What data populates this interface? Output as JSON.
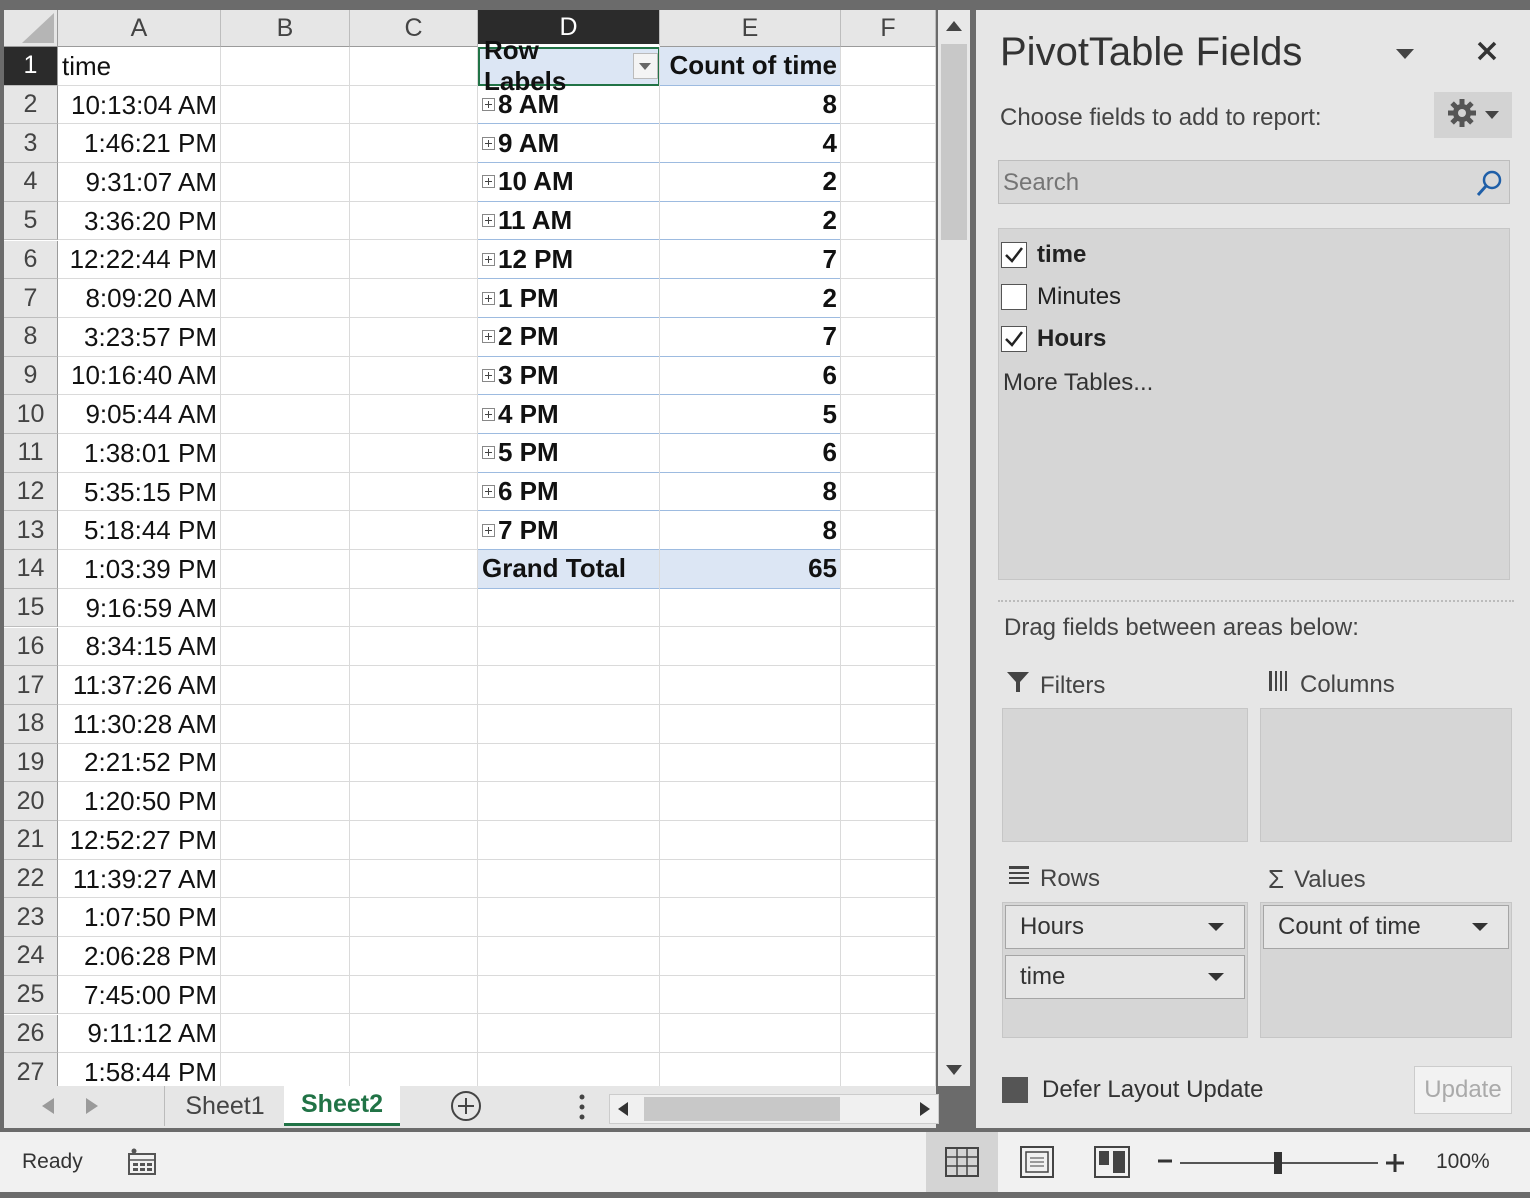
{
  "sheet": {
    "columns": [
      "A",
      "B",
      "C",
      "D",
      "E",
      "F"
    ],
    "selected_column": "D",
    "row_numbers": [
      "1",
      "2",
      "3",
      "4",
      "5",
      "6",
      "7",
      "8",
      "9",
      "10",
      "11",
      "12",
      "13",
      "14",
      "15",
      "16",
      "17",
      "18",
      "19",
      "20",
      "21",
      "22",
      "23",
      "24",
      "25",
      "26",
      "27"
    ],
    "colA_header": "time",
    "colA_values": [
      "10:13:04 AM",
      "1:46:21 PM",
      "9:31:07 AM",
      "3:36:20 PM",
      "12:22:44 PM",
      "8:09:20 AM",
      "3:23:57 PM",
      "10:16:40 AM",
      "9:05:44 AM",
      "1:38:01 PM",
      "5:35:15 PM",
      "5:18:44 PM",
      "1:03:39 PM",
      "9:16:59 AM",
      "8:34:15 AM",
      "11:37:26 AM",
      "11:30:28 AM",
      "2:21:52 PM",
      "1:20:50 PM",
      "12:52:27 PM",
      "11:39:27 AM",
      "1:07:50 PM",
      "2:06:28 PM",
      "7:45:00 PM",
      "9:11:12 AM",
      "1:58:44 PM"
    ]
  },
  "pivot": {
    "row_labels_header": "Row Labels",
    "values_header": "Count of time",
    "rows": [
      {
        "label": "8 AM",
        "count": "8"
      },
      {
        "label": "9 AM",
        "count": "4"
      },
      {
        "label": "10 AM",
        "count": "2"
      },
      {
        "label": "11 AM",
        "count": "2"
      },
      {
        "label": "12 PM",
        "count": "7"
      },
      {
        "label": "1 PM",
        "count": "2"
      },
      {
        "label": "2 PM",
        "count": "7"
      },
      {
        "label": "3 PM",
        "count": "6"
      },
      {
        "label": "4 PM",
        "count": "5"
      },
      {
        "label": "5 PM",
        "count": "6"
      },
      {
        "label": "6 PM",
        "count": "8"
      },
      {
        "label": "7 PM",
        "count": "8"
      }
    ],
    "grand_total_label": "Grand Total",
    "grand_total": "65"
  },
  "tabs": {
    "sheet1": "Sheet1",
    "sheet2": "Sheet2",
    "active": "Sheet2"
  },
  "status": {
    "ready": "Ready",
    "zoom": "100%"
  },
  "pane": {
    "title": "PivotTable Fields",
    "choose_label": "Choose fields to add to report:",
    "search_placeholder": "Search",
    "fields": [
      {
        "name": "time",
        "checked": true
      },
      {
        "name": "Minutes",
        "checked": false
      },
      {
        "name": "Hours",
        "checked": true
      }
    ],
    "more_tables": "More Tables...",
    "drag_label": "Drag fields between areas below:",
    "areas": {
      "filters_label": "Filters",
      "columns_label": "Columns",
      "rows_label": "Rows",
      "values_label": "Values",
      "rows_items": [
        "Hours",
        "time"
      ],
      "values_items": [
        "Count of time"
      ]
    },
    "defer_label": "Defer Layout Update",
    "update_label": "Update"
  },
  "colors": {
    "accent_green": "#217346",
    "pivot_header_fill": "#dce6f4"
  }
}
